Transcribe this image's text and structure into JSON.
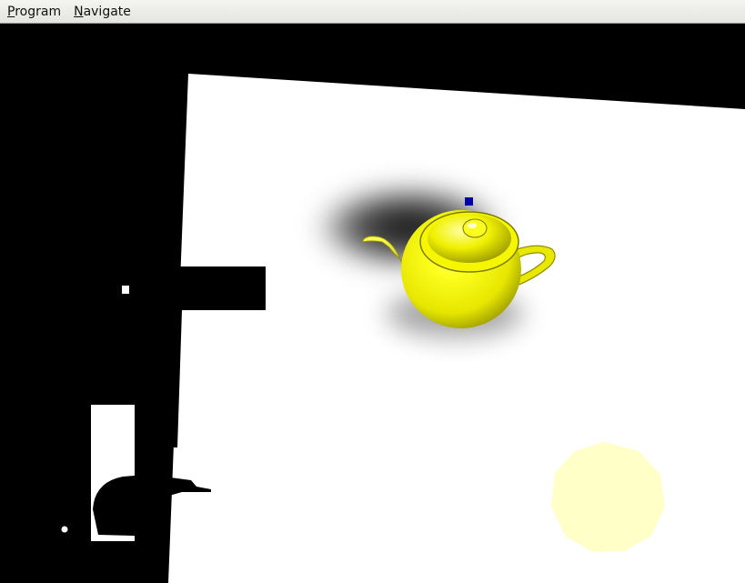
{
  "menubar": {
    "items": [
      {
        "mnemonic": "P",
        "rest": "rogram"
      },
      {
        "mnemonic": "N",
        "rest": "avigate"
      }
    ]
  },
  "scene": {
    "background_color": "#000000",
    "ground_color": "#ffffff",
    "teapot_color": "#ffff00",
    "light_color": "#ffffc8",
    "marker_color": "#0000aa"
  }
}
